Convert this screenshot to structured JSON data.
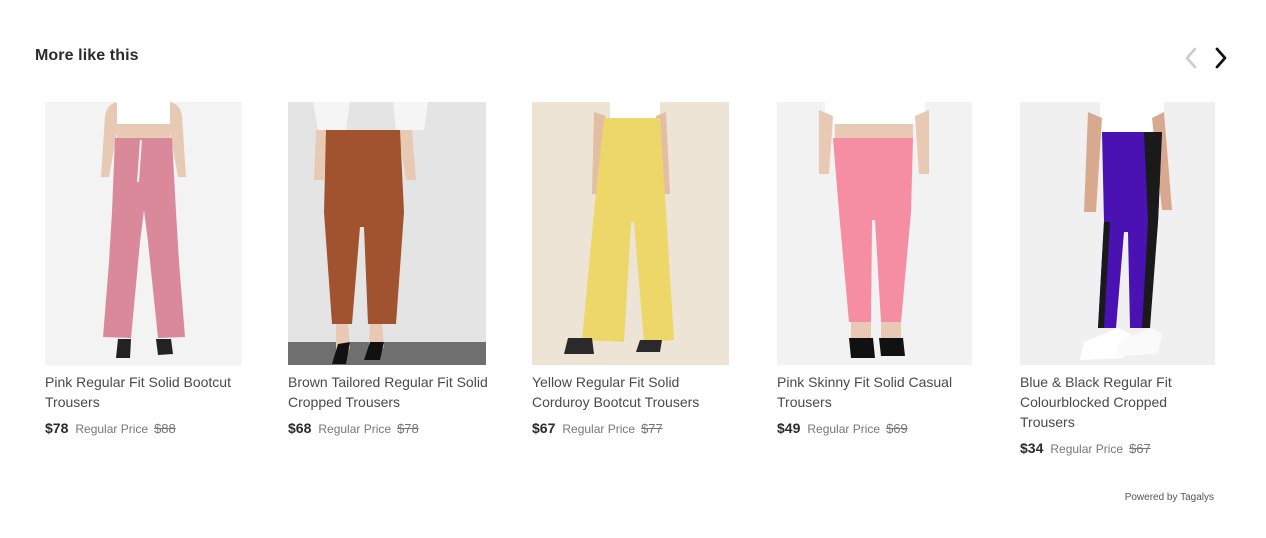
{
  "section": {
    "title": "More like this"
  },
  "navigation": {
    "prev_icon": "chevron-left-icon",
    "next_icon": "chevron-right-icon",
    "prev_color": "#cccccc",
    "next_color": "#111111"
  },
  "products": [
    {
      "name": "Pink Regular Fit Solid Bootcut Trousers",
      "price": "$78",
      "regular_label": "Regular Price",
      "regular_price": "$88",
      "trouser_color": "#d9899a",
      "background": "#f3f3f3"
    },
    {
      "name": "Brown Tailored Regular Fit Solid Cropped Trousers",
      "price": "$68",
      "regular_label": "Regular Price",
      "regular_price": "$78",
      "trouser_color": "#a0532e",
      "background": "#e4e4e4"
    },
    {
      "name": "Yellow Regular Fit Solid Corduroy Bootcut Trousers",
      "price": "$67",
      "regular_label": "Regular Price",
      "regular_price": "$77",
      "trouser_color": "#ecd768",
      "background": "#ede4d6"
    },
    {
      "name": "Pink Skinny Fit Solid Casual Trousers",
      "price": "$49",
      "regular_label": "Regular Price",
      "regular_price": "$69",
      "trouser_color": "#f58ea2",
      "background": "#f2f2f2"
    },
    {
      "name": "Blue & Black Regular Fit Colourblocked Cropped Trousers",
      "price": "$34",
      "regular_label": "Regular Price",
      "regular_price": "$67",
      "trouser_color": "#4a12b3",
      "background": "#f0f0f0"
    }
  ],
  "footer": {
    "powered_by": "Powered by Tagalys"
  }
}
